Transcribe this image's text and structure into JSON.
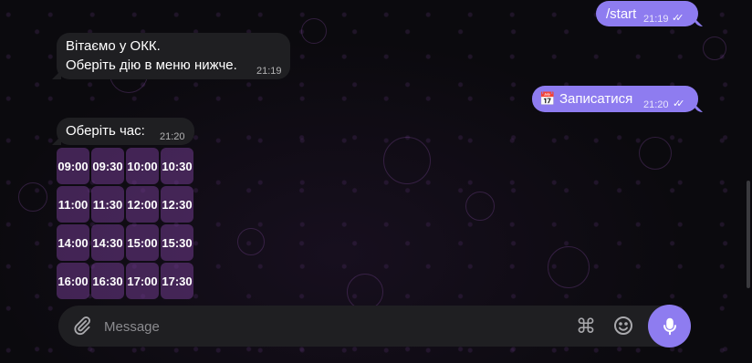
{
  "messages": {
    "start": {
      "text": "/start",
      "time": "21:19",
      "status": "read"
    },
    "welcome": {
      "line1": "Вітаємо у ОКК.",
      "line2": "Оберіть дію в меню нижче.",
      "time": "21:19"
    },
    "signup": {
      "emoji": "📅",
      "text": "Записатися",
      "time": "21:20",
      "status": "read"
    },
    "choose_time": {
      "text": "Оберіть час:",
      "time": "21:20"
    }
  },
  "time_slots": [
    [
      "09:00",
      "09:30",
      "10:00",
      "10:30"
    ],
    [
      "11:00",
      "11:30",
      "12:00",
      "12:30"
    ],
    [
      "14:00",
      "14:30",
      "15:00",
      "15:30"
    ],
    [
      "16:00",
      "16:30",
      "17:00",
      "17:30"
    ]
  ],
  "composer": {
    "placeholder": "Message",
    "icons": [
      "paperclip-icon",
      "command-icon",
      "emoji-icon",
      "microphone-icon"
    ]
  },
  "colors": {
    "accent": "#8e7cf0",
    "incoming_bubble": "#1f1f22",
    "keyboard_button": "#703a8c",
    "background": "#0b0a0e"
  }
}
